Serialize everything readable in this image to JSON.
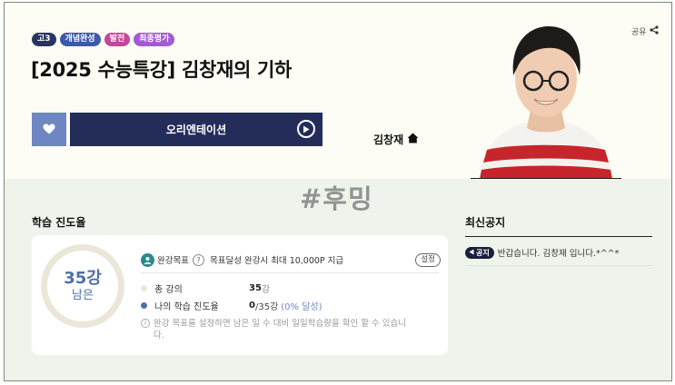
{
  "header": {
    "badges": [
      {
        "label": "고3",
        "color": "#2b3360"
      },
      {
        "label": "개념완성",
        "color": "#3b5aa8"
      },
      {
        "label": "발전",
        "color": "#c8459a"
      },
      {
        "label": "최종평가",
        "color": "#a25bd4"
      }
    ],
    "title": "[2025 수능특강] 김창재의 기하",
    "share_label": "공유",
    "orientation_label": "오리엔테이션",
    "teacher_name": "김창재"
  },
  "watermark": "#후밍",
  "progress": {
    "heading": "학습 진도율",
    "remaining_count": "35강",
    "remaining_label": "남은",
    "goal_label": "완강목표",
    "goal_help": "?",
    "goal_text": "목표달성 완강시 최대 10,000P 지급",
    "setting_label": "설정",
    "total_label": "총 강의",
    "total_value": "35",
    "total_unit": "강",
    "my_label": "나의 학습 진도율",
    "my_done": "0",
    "my_total": "/35강",
    "my_percent": "(0% 달성)",
    "note": "완강 목표를 설정하면 남은 일 수 대비 일일학습량을 확인 할 수 있습니다.",
    "info_icon": "i"
  },
  "notices": {
    "heading": "최신공지",
    "items": [
      {
        "tag": "공지",
        "text": "반갑습니다. 김창재 입니다.*^^*"
      }
    ]
  },
  "colors": {
    "accent_navy": "#242c5a",
    "accent_blue": "#6e87c3"
  },
  "icons": [
    "heart-icon",
    "play-circle-icon",
    "home-icon",
    "share-icon",
    "target-icon",
    "help-icon",
    "info-icon",
    "speaker-icon"
  ]
}
